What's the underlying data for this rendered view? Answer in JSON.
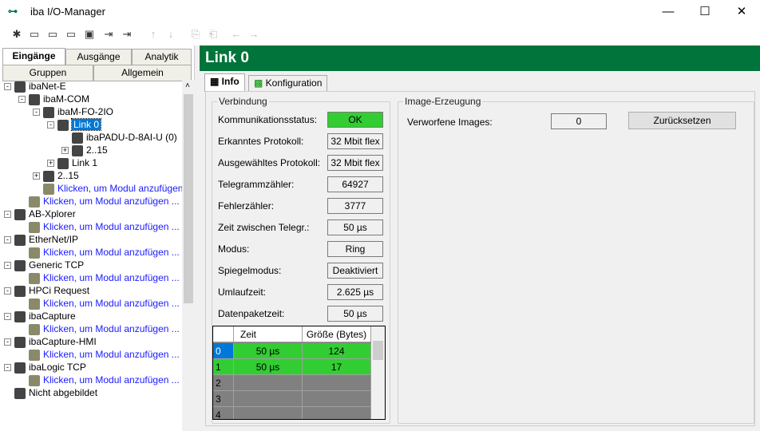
{
  "window": {
    "title": "iba I/O-Manager",
    "minimize": "—",
    "maximize": "☐",
    "close": "✕"
  },
  "toolbar": {
    "items": [
      "new-icon",
      "open-icon",
      "open-s-icon",
      "open-b-icon",
      "save-icon",
      "import-icon",
      "export-icon",
      "move-up-icon",
      "move-down-icon",
      "copy-icon",
      "paste-icon",
      "back-icon",
      "forward-icon"
    ]
  },
  "left": {
    "tabs_top": [
      "Eingänge",
      "Ausgänge",
      "Analytik"
    ],
    "tabs_bottom": [
      "Gruppen",
      "Allgemein"
    ],
    "tree": [
      {
        "label": "ibaNet-E",
        "level": 0,
        "exp": "−"
      },
      {
        "label": "ibaM-COM",
        "level": 1,
        "exp": "−"
      },
      {
        "label": "ibaM-FO-2IO",
        "level": 2,
        "exp": "−"
      },
      {
        "label": "Link 0",
        "level": 3,
        "exp": "−",
        "selected": true
      },
      {
        "label": "ibaPADU-D-8AI-U (0)",
        "level": 4,
        "exp": ""
      },
      {
        "label": "2..15",
        "level": 4,
        "exp": "+"
      },
      {
        "label": "Link 1",
        "level": 3,
        "exp": "+"
      },
      {
        "label": "2..15",
        "level": 2,
        "exp": "+"
      },
      {
        "label": "Klicken, um Modul anzufügen ...",
        "level": 2,
        "exp": "",
        "blue": true
      },
      {
        "label": "Klicken, um Modul anzufügen ...",
        "level": 1,
        "exp": "",
        "blue": true
      },
      {
        "label": "AB-Xplorer",
        "level": 0,
        "exp": "−"
      },
      {
        "label": "Klicken, um Modul anzufügen ...",
        "level": 1,
        "exp": "",
        "blue": true
      },
      {
        "label": "EtherNet/IP",
        "level": 0,
        "exp": "−"
      },
      {
        "label": "Klicken, um Modul anzufügen ...",
        "level": 1,
        "exp": "",
        "blue": true
      },
      {
        "label": "Generic TCP",
        "level": 0,
        "exp": "−"
      },
      {
        "label": "Klicken, um Modul anzufügen ...",
        "level": 1,
        "exp": "",
        "blue": true
      },
      {
        "label": "HPCi Request",
        "level": 0,
        "exp": "−"
      },
      {
        "label": "Klicken, um Modul anzufügen ...",
        "level": 1,
        "exp": "",
        "blue": true
      },
      {
        "label": "ibaCapture",
        "level": 0,
        "exp": "−"
      },
      {
        "label": "Klicken, um Modul anzufügen ...",
        "level": 1,
        "exp": "",
        "blue": true
      },
      {
        "label": "ibaCapture-HMI",
        "level": 0,
        "exp": "−"
      },
      {
        "label": "Klicken, um Modul anzufügen ...",
        "level": 1,
        "exp": "",
        "blue": true
      },
      {
        "label": "ibaLogic TCP",
        "level": 0,
        "exp": "−"
      },
      {
        "label": "Klicken, um Modul anzufügen ...",
        "level": 1,
        "exp": "",
        "blue": true
      },
      {
        "label": "Nicht abgebildet",
        "level": 0,
        "exp": ""
      }
    ]
  },
  "header": {
    "title": "Link 0"
  },
  "tabs": [
    "Info",
    "Konfiguration"
  ],
  "verbindung": {
    "title": "Verbindung",
    "rows": [
      {
        "label": "Kommunikationsstatus:",
        "value": "OK",
        "ok": true
      },
      {
        "label": "Erkanntes Protokoll:",
        "value": "32 Mbit flex"
      },
      {
        "label": "Ausgewähltes Protokoll:",
        "value": "32 Mbit flex"
      },
      {
        "label": "Telegrammzähler:",
        "value": "64927"
      },
      {
        "label": "Fehlerzähler:",
        "value": "3777"
      },
      {
        "label": "Zeit zwischen Telegr.:",
        "value": "50 µs"
      },
      {
        "label": "Modus:",
        "value": "Ring"
      },
      {
        "label": "Spiegelmodus:",
        "value": "Deaktiviert"
      },
      {
        "label": "Umlaufzeit:",
        "value": "2.625 µs"
      },
      {
        "label": "Datenpaketzeit:",
        "value": "50 µs"
      }
    ],
    "grid": {
      "headers": [
        "",
        "Zeit",
        "Größe (Bytes)"
      ],
      "rows": [
        [
          "0",
          "50 µs",
          "124"
        ],
        [
          "1",
          "50 µs",
          "17"
        ],
        [
          "2",
          "",
          ""
        ],
        [
          "3",
          "",
          ""
        ],
        [
          "4",
          "",
          ""
        ]
      ]
    }
  },
  "image": {
    "title": "Image-Erzeugung",
    "label": "Verworfene Images:",
    "value": "0",
    "reset": "Zurücksetzen"
  },
  "colors": {
    "header": "#00743a",
    "ok": "#32cd32",
    "selected": "#0078d7"
  }
}
